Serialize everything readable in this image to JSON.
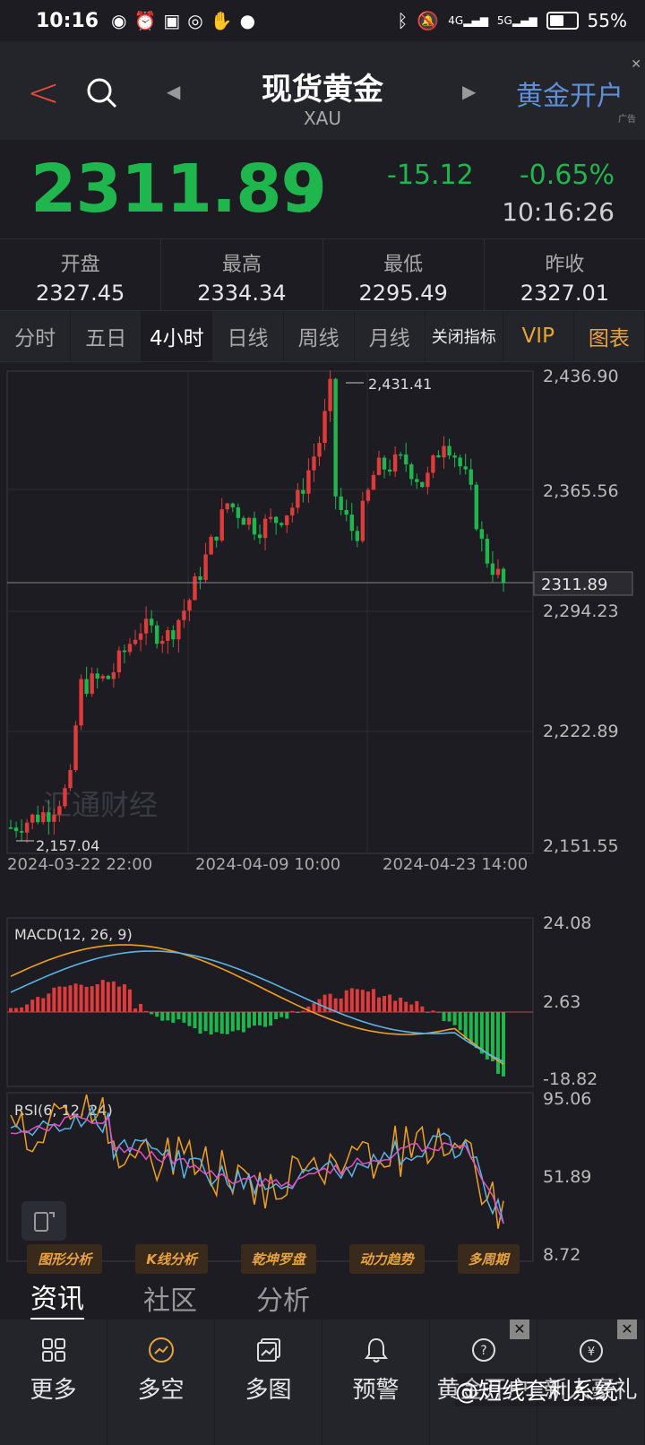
{
  "status": {
    "time": "10:16",
    "battery": "55%",
    "battery_level": 0.55,
    "net_4g": "4G",
    "net_5g": "5G"
  },
  "header": {
    "title": "现货黄金",
    "subtitle": "XAU",
    "ad_text": "黄金开户",
    "ad_tag": "广告"
  },
  "quote": {
    "price": "2311.89",
    "change": "-15.12",
    "change_pct": "-0.65%",
    "time": "10:16:26"
  },
  "stats": [
    {
      "label": "开盘",
      "value": "2327.45"
    },
    {
      "label": "最高",
      "value": "2334.34"
    },
    {
      "label": "最低",
      "value": "2295.49"
    },
    {
      "label": "昨收",
      "value": "2327.01"
    }
  ],
  "periods": [
    "分时",
    "五日",
    "4小时",
    "日线",
    "周线",
    "月线",
    "关闭指标",
    "VIP",
    "图表"
  ],
  "active_period": "4小时",
  "chart_labels": {
    "y_ticks": [
      "2,436.90",
      "2,365.56",
      "2,294.23",
      "2,222.89",
      "2,151.55"
    ],
    "current_price": "2311.89",
    "high_label": "2,431.41",
    "low_label": "2,157.04",
    "x_ticks": [
      "2024-03-22 22:00",
      "2024-04-09 10:00",
      "2024-04-23 14:00"
    ],
    "macd_title": "MACD(12, 26, 9)",
    "macd_ticks": [
      "24.08",
      "2.63",
      "-18.82"
    ],
    "rsi_title": "RSI(6, 12, 24)",
    "rsi_ticks": [
      "95.06",
      "51.89",
      "8.72"
    ],
    "watermark": "汇通财经"
  },
  "tools": [
    "图形分析",
    "K线分析",
    "乾坤罗盘",
    "动力趋势",
    "多周期"
  ],
  "news_tabs": [
    "资讯",
    "社区",
    "分析"
  ],
  "bottom_nav": [
    {
      "label": "更多",
      "icon": "grid-icon"
    },
    {
      "label": "多空",
      "icon": "trend-circle-icon"
    },
    {
      "label": "多图",
      "icon": "multi-chart-icon"
    },
    {
      "label": "预警",
      "icon": "bell-icon"
    },
    {
      "label": "黄金开户",
      "icon": "open-account-icon"
    },
    {
      "label": "新人豪礼",
      "icon": "gift-icon"
    }
  ],
  "overlay_watermark": "@短线套利系统",
  "colors": {
    "up": "#e03b3b",
    "down": "#1fb64e",
    "accent": "#e8a33d",
    "link": "#5f8fd6"
  }
}
